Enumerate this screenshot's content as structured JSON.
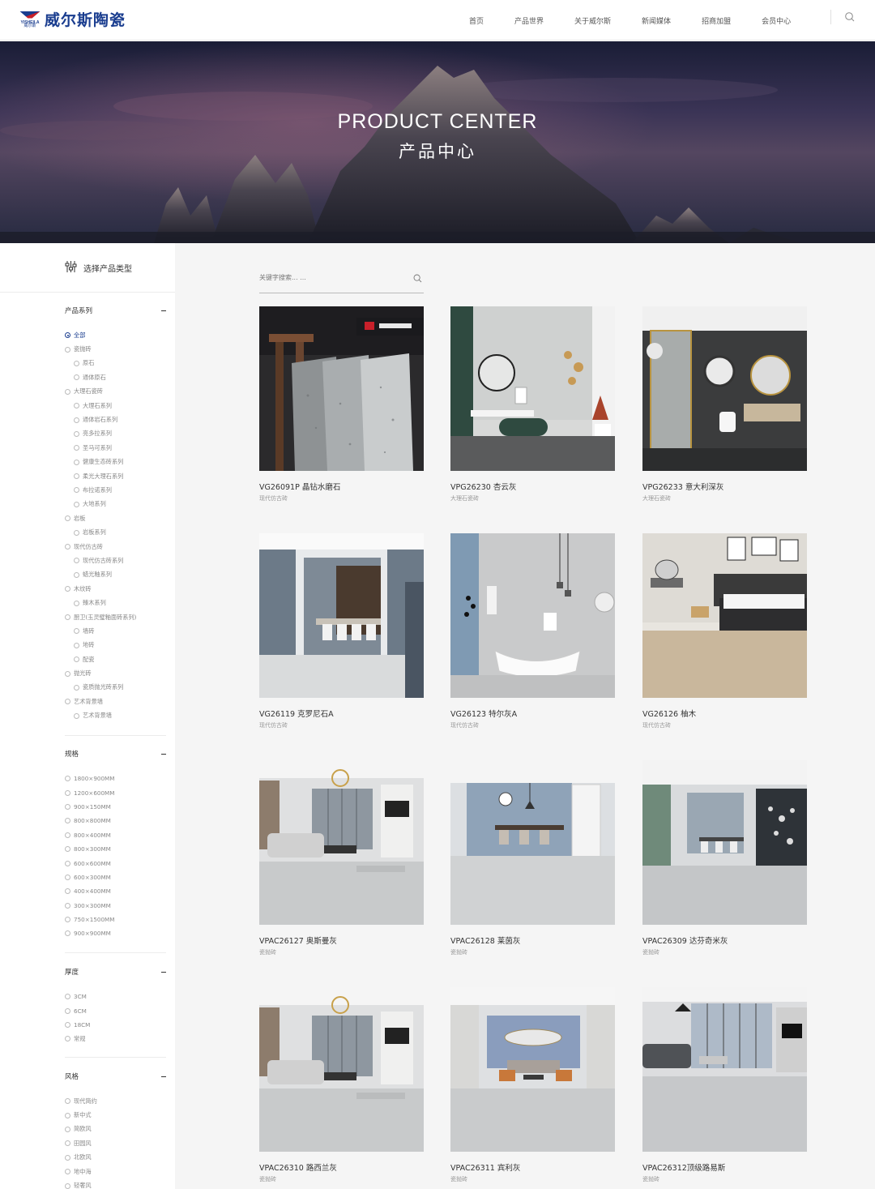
{
  "header": {
    "logo_text": "威尔斯陶瓷",
    "logo_mark_text": "YISHEILA",
    "logo_mark_sub": "威尔斯",
    "nav": [
      "首页",
      "产品世界",
      "关于威尔斯",
      "新闻媒体",
      "招商加盟",
      "会员中心"
    ]
  },
  "banner": {
    "title": "PRODUCT CENTER",
    "subtitle": "产品中心"
  },
  "sidebar": {
    "head_label": "选择产品类型",
    "series": {
      "title": "产品系列",
      "options": [
        {
          "label": "全部",
          "level": 0,
          "selected": true
        },
        {
          "label": "瓷抛砖",
          "level": 0
        },
        {
          "label": "原石",
          "level": 1
        },
        {
          "label": "通体原石",
          "level": 1
        },
        {
          "label": "大理石瓷砖",
          "level": 0
        },
        {
          "label": "大理石系列",
          "level": 1
        },
        {
          "label": "通体岩石系列",
          "level": 1
        },
        {
          "label": "亮多拉系列",
          "level": 1
        },
        {
          "label": "圣马可系列",
          "level": 1
        },
        {
          "label": "健康生态砖系列",
          "level": 1
        },
        {
          "label": "柔光大理石系列",
          "level": 1
        },
        {
          "label": "布拉诺系列",
          "level": 1
        },
        {
          "label": "大地系列",
          "level": 1
        },
        {
          "label": "岩板",
          "level": 0
        },
        {
          "label": "岩板系列",
          "level": 1
        },
        {
          "label": "现代仿古砖",
          "level": 0
        },
        {
          "label": "现代仿古砖系列",
          "level": 1
        },
        {
          "label": "蜡光釉系列",
          "level": 1
        },
        {
          "label": "木纹砖",
          "level": 0
        },
        {
          "label": "臻木系列",
          "level": 1
        },
        {
          "label": "厨卫(玉灵璧釉面砖系列)",
          "level": 0
        },
        {
          "label": "墙砖",
          "level": 1
        },
        {
          "label": "地砖",
          "level": 1
        },
        {
          "label": "配瓷",
          "level": 1
        },
        {
          "label": "抛光砖",
          "level": 0
        },
        {
          "label": "瓷质抛光砖系列",
          "level": 1
        },
        {
          "label": "艺术背景墙",
          "level": 0
        },
        {
          "label": "艺术背景墙",
          "level": 1
        }
      ]
    },
    "spec": {
      "title": "规格",
      "options": [
        "1800×900MM",
        "1200×600MM",
        "900×150MM",
        "800×800MM",
        "800×400MM",
        "800×300MM",
        "600×600MM",
        "600×300MM",
        "400×400MM",
        "300×300MM",
        "750×1500MM",
        "900×900MM"
      ]
    },
    "thickness": {
      "title": "厚度",
      "options": [
        "3CM",
        "6CM",
        "18CM",
        "常规"
      ]
    },
    "style": {
      "title": "风格",
      "options": [
        "现代简约",
        "新中式",
        "简欧风",
        "田园风",
        "北欧风",
        "地中海",
        "轻奢风"
      ]
    }
  },
  "search": {
    "placeholder": "关键字搜索... ..."
  },
  "products": [
    {
      "title": "VG26091P 晶钻水磨石",
      "category": "现代仿古砖",
      "scene": "terrazzo"
    },
    {
      "title": "VPG26230 杏云灰",
      "category": "大理石瓷砖",
      "scene": "bath-green"
    },
    {
      "title": "VPG26233 意大利深灰",
      "category": "大理石瓷砖",
      "scene": "bath-dark"
    },
    {
      "title": "VG26119 克罗尼石A",
      "category": "现代仿古砖",
      "scene": "dining-blue"
    },
    {
      "title": "VG26123 特尔灰A",
      "category": "现代仿古砖",
      "scene": "bath-blue"
    },
    {
      "title": "VG26126 柚木",
      "category": "现代仿古砖",
      "scene": "bedroom"
    },
    {
      "title": "VPAC26127 奥斯曼灰",
      "category": "瓷抛砖",
      "scene": "living"
    },
    {
      "title": "VPAC26128 莱茵灰",
      "category": "瓷抛砖",
      "scene": "dining-light"
    },
    {
      "title": "VPAC26309 达芬奇米灰",
      "category": "瓷抛砖",
      "scene": "dining-dark"
    },
    {
      "title": "VPAC26310 路西兰灰",
      "category": "瓷抛砖",
      "scene": "living"
    },
    {
      "title": "VPAC26311 宾利灰",
      "category": "瓷抛砖",
      "scene": "living-blue"
    },
    {
      "title": "VPAC26312顶级路易斯",
      "category": "瓷抛砖",
      "scene": "living-window"
    }
  ],
  "colors": {
    "brand": "#1a3d8f",
    "accent_red": "#c8202a"
  }
}
